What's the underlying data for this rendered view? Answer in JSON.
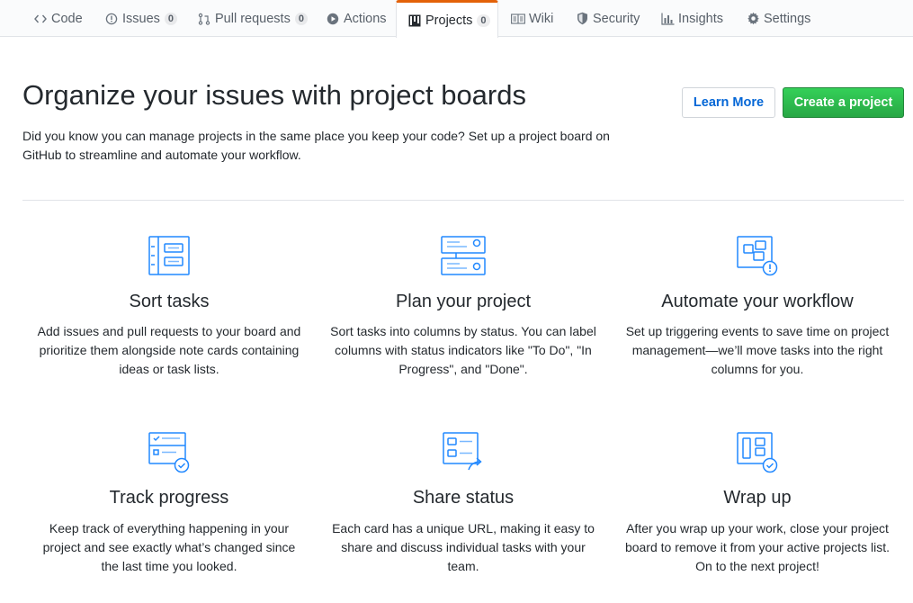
{
  "tabs": [
    {
      "label": "Code",
      "icon": "code-icon"
    },
    {
      "label": "Issues",
      "icon": "issue-opened-icon",
      "count": "0"
    },
    {
      "label": "Pull requests",
      "icon": "git-pull-request-icon",
      "count": "0"
    },
    {
      "label": "Actions",
      "icon": "play-icon"
    },
    {
      "label": "Projects",
      "icon": "project-icon",
      "count": "0",
      "selected": true
    },
    {
      "label": "Wiki",
      "icon": "book-icon"
    },
    {
      "label": "Security",
      "icon": "shield-icon"
    },
    {
      "label": "Insights",
      "icon": "graph-icon"
    },
    {
      "label": "Settings",
      "icon": "gear-icon"
    }
  ],
  "header": {
    "title": "Organize your issues with project boards",
    "description": "Did you know you can manage projects in the same place you keep your code? Set up a project board on GitHub to streamline and automate your workflow.",
    "learn_more": "Learn More",
    "create_project": "Create a project"
  },
  "features": [
    {
      "title": "Sort tasks",
      "text": "Add issues and pull requests to your board and prioritize them alongside note cards containing ideas or task lists.",
      "icon": "sort-tasks-icon"
    },
    {
      "title": "Plan your project",
      "text": "Sort tasks into columns by status. You can label columns with status indicators like \"To Do\", \"In Progress\", and \"Done\".",
      "icon": "plan-project-icon"
    },
    {
      "title": "Automate your workflow",
      "text": "Set up triggering events to save time on project management—we’ll move tasks into the right columns for you.",
      "icon": "automate-workflow-icon"
    },
    {
      "title": "Track progress",
      "text": "Keep track of everything happening in your project and see exactly what’s changed since the last time you looked.",
      "icon": "track-progress-icon"
    },
    {
      "title": "Share status",
      "text": "Each card has a unique URL, making it easy to share and discuss individual tasks with your team.",
      "icon": "share-status-icon"
    },
    {
      "title": "Wrap up",
      "text": "After you wrap up your work, close your project board to remove it from your active projects list. On to the next project!",
      "icon": "wrap-up-icon"
    }
  ],
  "colors": {
    "accent": "#0366d6",
    "icon_blue": "#2188ff",
    "tab_active_border": "#e36209",
    "create_button": "#28a745"
  }
}
